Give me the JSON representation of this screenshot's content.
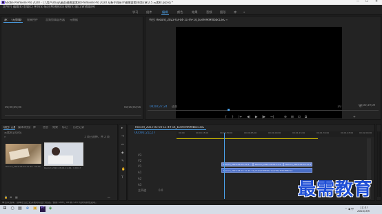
{
  "window": {
    "title": "Adobe Premiere Pro 2020 - C:\\用户\\shuy\\桌面\\最需要素材 Premiere Pro 2020 从新手到高手\\最需要素材\\第2章\\2.5 元素材.prproj *",
    "minimize": "—",
    "maximize": "☐",
    "close": "✕"
  },
  "menu": [
    "文件(F)",
    "编辑(E)",
    "剪辑(C)",
    "序列(S)",
    "标记(M)",
    "图形(G)",
    "视图(V)",
    "窗口(W)",
    "帮助(H)"
  ],
  "workspace_tabs": {
    "items": [
      "学习",
      "组件",
      "编辑",
      "颜色",
      "效果",
      "音频",
      "图形",
      "库"
    ],
    "active_index": 2,
    "more": "»"
  },
  "source_panel": {
    "tabs": [
      "源：（无剪辑）",
      "效果控件",
      "音频剪辑混合器",
      "元数据"
    ],
    "timecode_left": "00;00;00;00",
    "timecode_right": "00;00;00;00"
  },
  "program_panel": {
    "tab": "节目: Record_2022-03-04-11-49-14_b3efe9d9f0bbc1ae23ba7fdd2f8fcfc4",
    "menu_icon": "≡",
    "timecode": "00;00;27;24",
    "fit_label": "适合",
    "quality_label": "1/2",
    "end_timecode": "00;00;39;09",
    "controls": [
      "{",
      "}",
      "|←",
      "◀|",
      "▶",
      "|▶",
      "→|",
      "⊕",
      "⊞",
      "⊡",
      "⧉",
      "+"
    ]
  },
  "project_panel": {
    "tabs": [
      "项目: 元素材",
      "媒体浏览器",
      "库",
      "信息",
      "效果",
      "标记",
      "历史记录"
    ],
    "file_label": "元素材.prproj",
    "item_count": "1 项已选择，共 2 项",
    "clips": [
      {
        "name": "Record_2022-03-04-11-49-...",
        "duration": "50:54"
      },
      {
        "name": "Record_2022-03-04-11-49-...",
        "duration": "1:00;17"
      }
    ]
  },
  "tools": [
    "▸",
    "⇥",
    "↔",
    "◆",
    "✎",
    "✋",
    "T"
  ],
  "timeline": {
    "tab": "Record_2022-03-04-11-49-14_b3efe9d9f0bbc1ae23ba7fdd2f8fcfc4",
    "timecode": "00;00;21;27",
    "ruler_ticks": [
      "00;00",
      "00;00;15;00",
      "00;00;30;00",
      "00;00;45;00",
      "00;01;00;00",
      "00;01;15;00",
      "00;01;30;00",
      "00;01;45;00",
      "00;02;00;00"
    ],
    "video_tracks": [
      "V3",
      "V2",
      "V1"
    ],
    "audio_tracks": [
      "A1",
      "A2",
      "A3"
    ],
    "master_label": "主声道",
    "master_value": "0.0",
    "video_clips": [
      "Record_2022-03-04-11-4",
      "Record_2022-03-04-11-4",
      "Record_2022-03-04-11-4"
    ],
    "audio_clip": "Record_2022-03-04-11-49-14_b3efe9d9f0bbc1ae23ba7fdd2f8fcfc4"
  },
  "status_bar": {
    "text": "单击以选择，或单击空白处并拖动以进行框选。使用 Shift、Alt 和 Ctrl 可获得其他选项。"
  },
  "watermark": "最需教育",
  "taskbar": {
    "icons": [
      "⊞",
      "○",
      "▤",
      "e",
      "▣",
      "Pr",
      "◈"
    ],
    "tray": "^ ◀ 中",
    "time": "11:47",
    "date": "2022/3/4"
  },
  "colors": {
    "accent": "#4a9fe6",
    "video_clip": "#6d8ad6",
    "audio_clip": "#4b6fc6",
    "watermark": "#1f4fd6"
  }
}
